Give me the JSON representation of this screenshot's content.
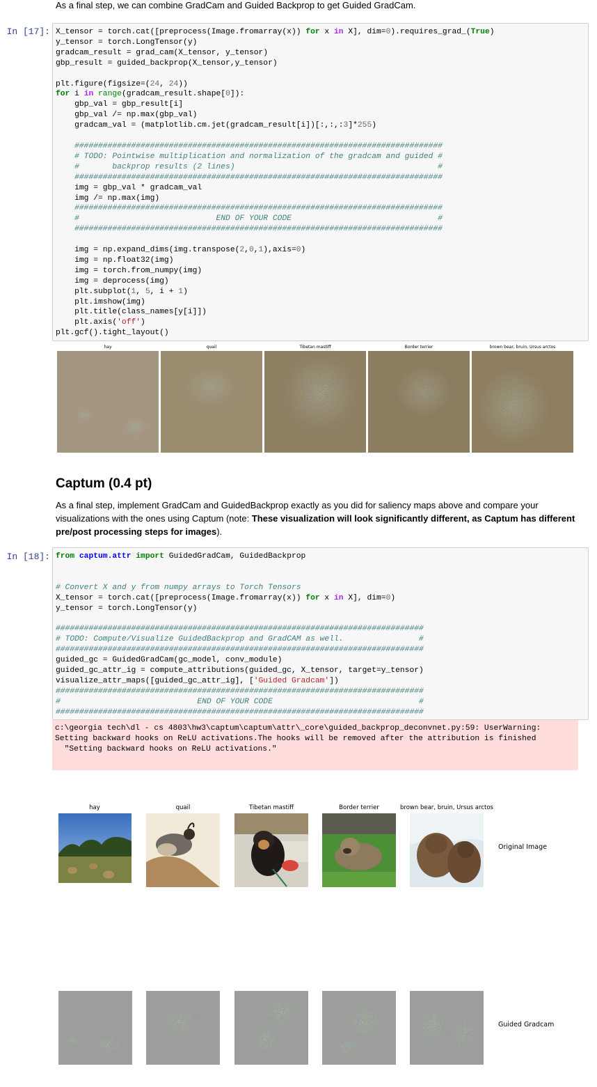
{
  "intro_text": "As a final step, we can combine GradCam and Guided Backprop to get Guided GradCam.",
  "cell17": {
    "prompt": "In [17]:"
  },
  "cell18": {
    "prompt": "In [18]:"
  },
  "plot_titles": [
    "hay",
    "quail",
    "Tibetan mastiff",
    "Border terrier",
    "brown bear, bruin, Ursus arctos"
  ],
  "captum": {
    "heading": "Captum (0.4 pt)",
    "para_plain": "As a final step, implement GradCam and GuidedBackprop exactly as you did for saliency maps above and compare your visualizations with the ones using Captum (note: ",
    "para_bold": "These visualization will look significantly different, as Captum has different pre/post processing steps for images",
    "para_end": ")."
  },
  "stderr_text": "c:\\georgia tech\\dl - cs 4803\\hw3\\captum\\captum\\attr\\_core\\guided_backprop_deconvnet.py:59: UserWarning: Setting backward hooks on ReLU activations.The hooks will be removed after the attribution is finished\n  \"Setting backward hooks on ReLU activations.\"",
  "row_labels": {
    "original": "Original Image",
    "guided": "Guided Gradcam"
  },
  "colors": {
    "prompt": "#303f9f",
    "stderr_bg": "#ffdddd",
    "cell_bg": "#f7f7f7"
  }
}
